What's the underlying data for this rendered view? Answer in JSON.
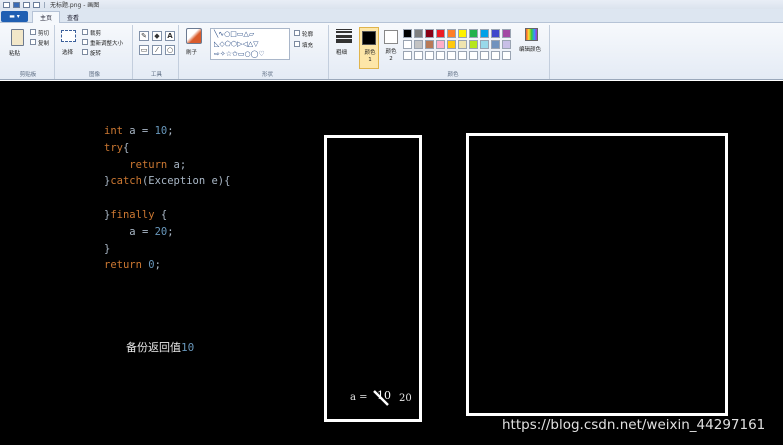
{
  "window": {
    "title": "无标题.png - 画图"
  },
  "menu": {
    "app_button": "",
    "tabs": [
      {
        "label": "主页",
        "active": true
      },
      {
        "label": "查看",
        "active": false
      }
    ]
  },
  "ribbon": {
    "clipboard": {
      "label": "剪贴板",
      "paste": "粘贴",
      "cut": "剪切",
      "copy": "复制"
    },
    "image": {
      "label": "图像",
      "select": "选择",
      "crop": "裁剪",
      "resize": "重新调整大小",
      "rotate": "旋转"
    },
    "tools": {
      "label": "工具"
    },
    "brushes": {
      "label": "刷子"
    },
    "shapes": {
      "label": "形状",
      "outline": "轮廓",
      "fill": "填充"
    },
    "size": {
      "label": "粗细"
    },
    "colors": {
      "label": "颜色",
      "color1": "颜色 1",
      "color2": "颜色 2",
      "edit": "编辑颜色",
      "color1_value": "#000000",
      "color2_value": "#ffffff",
      "palette": [
        "#000000",
        "#7f7f7f",
        "#880015",
        "#ed1c24",
        "#ff7f27",
        "#fff200",
        "#22b14c",
        "#00a2e8",
        "#3f48cc",
        "#a349a4",
        "#ffffff",
        "#c3c3c3",
        "#b97a57",
        "#ffaec9",
        "#ffc90e",
        "#efe4b0",
        "#b5e61d",
        "#99d9ea",
        "#7092be",
        "#c8bfe7",
        "#ffffff",
        "#ffffff",
        "#ffffff",
        "#ffffff",
        "#ffffff",
        "#ffffff",
        "#ffffff",
        "#ffffff",
        "#ffffff",
        "#ffffff"
      ]
    }
  },
  "canvas": {
    "code": {
      "line1": {
        "kw": "int",
        "rest": " a = ",
        "num": "10",
        "end": ";"
      },
      "line2": {
        "kw": "try",
        "rest": "{"
      },
      "line3": {
        "indent": "    ",
        "kw": "return",
        "rest": " a;"
      },
      "line4": {
        "pre": "}",
        "kw": "catch",
        "rest": "(Exception e){"
      },
      "line5": {},
      "line6": {
        "pre": "}",
        "kw": "finally",
        "rest": " {"
      },
      "line7": {
        "indent": "    ",
        "rest": "a = ",
        "num": "20",
        "end": ";"
      },
      "line8": {
        "rest": "}"
      },
      "line9": {
        "kw": "return",
        "rest": " ",
        "num": "0",
        "end": ";"
      }
    },
    "note": {
      "text": "备份返回值",
      "value": "10"
    },
    "stack_var": {
      "label": "a =",
      "old_value": "10",
      "new_value": "20"
    },
    "watermark": "https://blog.csdn.net/weixin_44297161"
  }
}
